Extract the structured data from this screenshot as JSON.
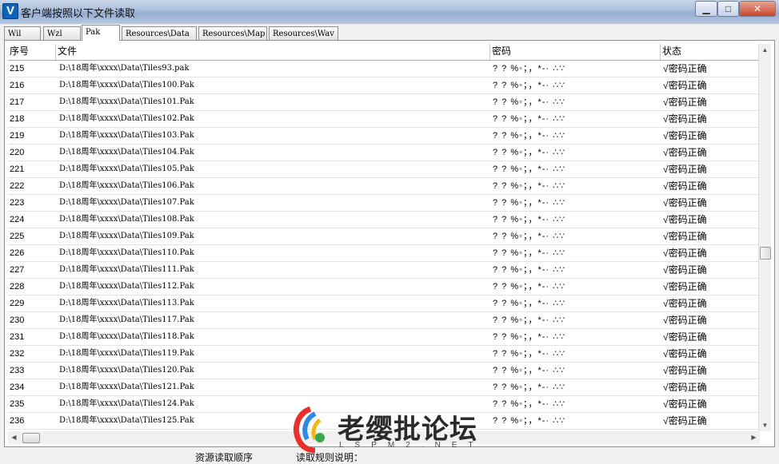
{
  "window": {
    "title": "客户端按照以下文件读取",
    "app_icon_letter": "V",
    "minimize_glyph": "▁",
    "maximize_glyph": "□",
    "close_glyph": "✕"
  },
  "tabs": [
    {
      "label": "Wil",
      "active": false
    },
    {
      "label": "Wzl",
      "active": false
    },
    {
      "label": "Pak",
      "active": true
    },
    {
      "label": "Resources\\Data",
      "active": false
    },
    {
      "label": "Resources\\Map",
      "active": false
    },
    {
      "label": "Resources\\Wav",
      "active": false
    }
  ],
  "table": {
    "columns": [
      "序号",
      "文件",
      "密码",
      "状态"
    ],
    "rows": [
      {
        "idx": "215",
        "file": "D:\\18周年\\xxxx\\Data\\Tiles93.pak",
        "pwd": "? ? %◦；，*-· ∴∵",
        "status": "√密码正确"
      },
      {
        "idx": "216",
        "file": "D:\\18周年\\xxxx\\Data\\Tiles100.Pak",
        "pwd": "? ? %◦；，*-· ∴∵",
        "status": "√密码正确"
      },
      {
        "idx": "217",
        "file": "D:\\18周年\\xxxx\\Data\\Tiles101.Pak",
        "pwd": "? ? %◦；，*-· ∴∵",
        "status": "√密码正确"
      },
      {
        "idx": "218",
        "file": "D:\\18周年\\xxxx\\Data\\Tiles102.Pak",
        "pwd": "? ? %◦；，*-· ∴∵",
        "status": "√密码正确"
      },
      {
        "idx": "219",
        "file": "D:\\18周年\\xxxx\\Data\\Tiles103.Pak",
        "pwd": "? ? %◦；，*-· ∴∵",
        "status": "√密码正确"
      },
      {
        "idx": "220",
        "file": "D:\\18周年\\xxxx\\Data\\Tiles104.Pak",
        "pwd": "? ? %◦；，*-· ∴∵",
        "status": "√密码正确"
      },
      {
        "idx": "221",
        "file": "D:\\18周年\\xxxx\\Data\\Tiles105.Pak",
        "pwd": "? ? %◦；，*-· ∴∵",
        "status": "√密码正确"
      },
      {
        "idx": "222",
        "file": "D:\\18周年\\xxxx\\Data\\Tiles106.Pak",
        "pwd": "? ? %◦；，*-· ∴∵",
        "status": "√密码正确"
      },
      {
        "idx": "223",
        "file": "D:\\18周年\\xxxx\\Data\\Tiles107.Pak",
        "pwd": "? ? %◦；，*-· ∴∵",
        "status": "√密码正确"
      },
      {
        "idx": "224",
        "file": "D:\\18周年\\xxxx\\Data\\Tiles108.Pak",
        "pwd": "? ? %◦；，*-· ∴∵",
        "status": "√密码正确"
      },
      {
        "idx": "225",
        "file": "D:\\18周年\\xxxx\\Data\\Tiles109.Pak",
        "pwd": "? ? %◦；，*-· ∴∵",
        "status": "√密码正确"
      },
      {
        "idx": "226",
        "file": "D:\\18周年\\xxxx\\Data\\Tiles110.Pak",
        "pwd": "? ? %◦；，*-· ∴∵",
        "status": "√密码正确"
      },
      {
        "idx": "227",
        "file": "D:\\18周年\\xxxx\\Data\\Tiles111.Pak",
        "pwd": "? ? %◦；，*-· ∴∵",
        "status": "√密码正确"
      },
      {
        "idx": "228",
        "file": "D:\\18周年\\xxxx\\Data\\Tiles112.Pak",
        "pwd": "? ? %◦；，*-· ∴∵",
        "status": "√密码正确"
      },
      {
        "idx": "229",
        "file": "D:\\18周年\\xxxx\\Data\\Tiles113.Pak",
        "pwd": "? ? %◦；，*-· ∴∵",
        "status": "√密码正确"
      },
      {
        "idx": "230",
        "file": "D:\\18周年\\xxxx\\Data\\Tiles117.Pak",
        "pwd": "? ? %◦；，*-· ∴∵",
        "status": "√密码正确"
      },
      {
        "idx": "231",
        "file": "D:\\18周年\\xxxx\\Data\\Tiles118.Pak",
        "pwd": "? ? %◦；，*-· ∴∵",
        "status": "√密码正确"
      },
      {
        "idx": "232",
        "file": "D:\\18周年\\xxxx\\Data\\Tiles119.Pak",
        "pwd": "? ? %◦；，*-· ∴∵",
        "status": "√密码正确"
      },
      {
        "idx": "233",
        "file": "D:\\18周年\\xxxx\\Data\\Tiles120.Pak",
        "pwd": "? ? %◦；，*-· ∴∵",
        "status": "√密码正确"
      },
      {
        "idx": "234",
        "file": "D:\\18周年\\xxxx\\Data\\Tiles121.Pak",
        "pwd": "? ? %◦；，*-· ∴∵",
        "status": "√密码正确"
      },
      {
        "idx": "235",
        "file": "D:\\18周年\\xxxx\\Data\\Tiles124.Pak",
        "pwd": "? ? %◦；，*-· ∴∵",
        "status": "√密码正确"
      },
      {
        "idx": "236",
        "file": "D:\\18周年\\xxxx\\Data\\Tiles125.Pak",
        "pwd": "? ? %◦；，*-· ∴∵",
        "status": "√密码正确"
      }
    ]
  },
  "scrollbar": {
    "up_glyph": "▲",
    "down_glyph": "▼",
    "left_glyph": "◀",
    "right_glyph": "▶"
  },
  "bottom_labels": [
    "资源读取顺序",
    "读取规则说明："
  ],
  "watermark": {
    "text": "老缨批论坛",
    "sub": "LSPM2.NET"
  }
}
